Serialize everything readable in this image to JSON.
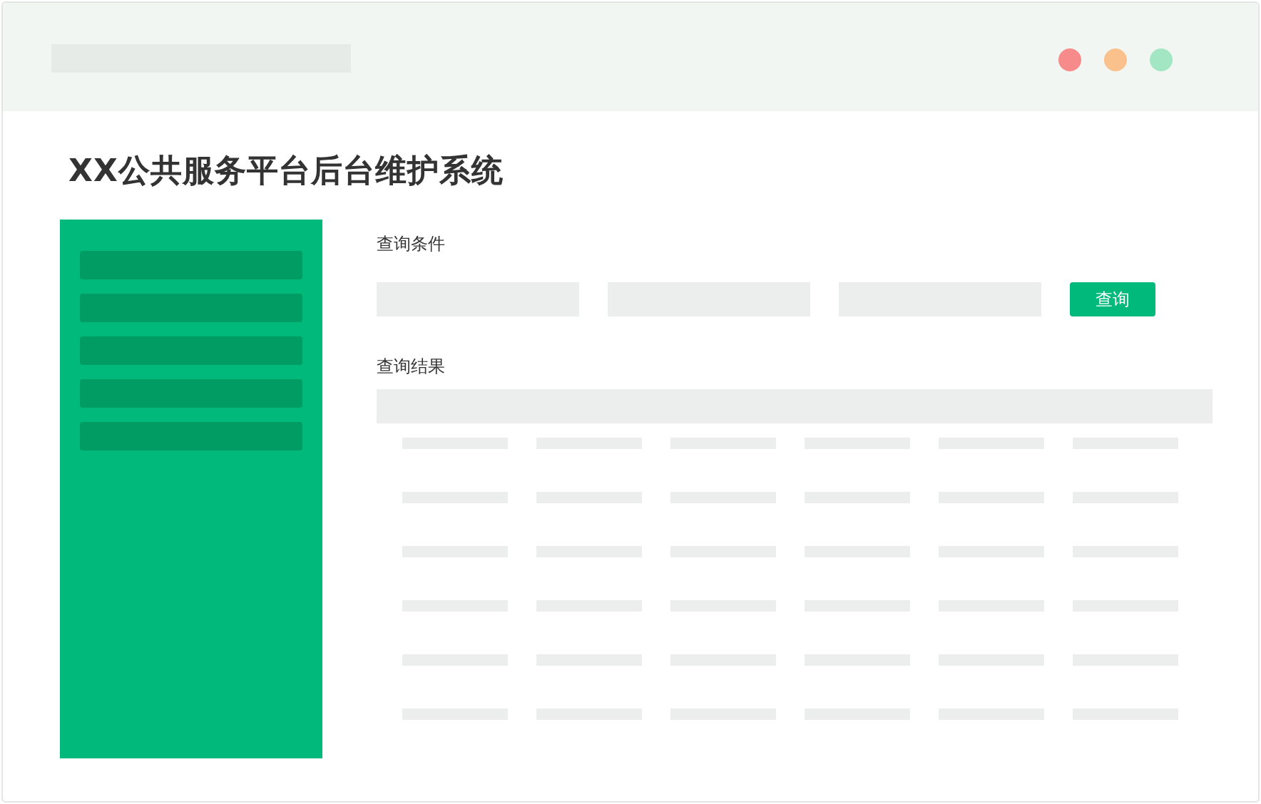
{
  "page": {
    "title": "XX公共服务平台后台维护系统"
  },
  "query": {
    "heading": "查询条件",
    "button": "查询"
  },
  "results": {
    "heading": "查询结果"
  }
}
